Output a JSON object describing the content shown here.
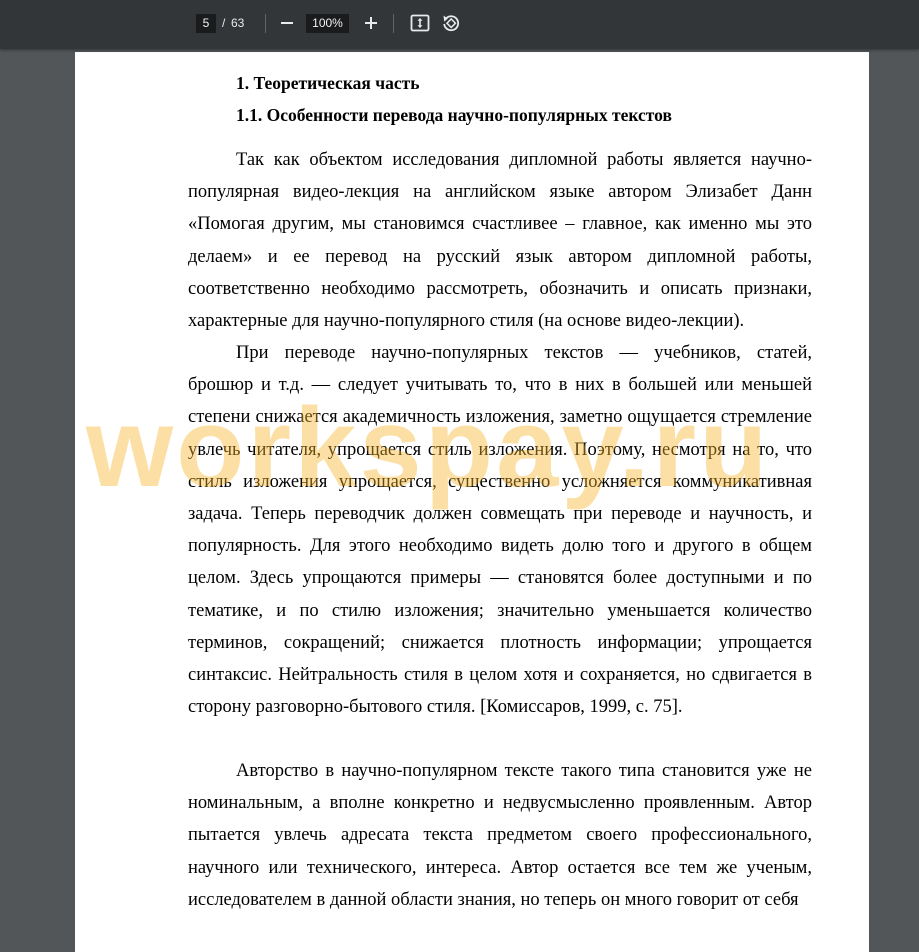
{
  "toolbar": {
    "page_current": "5",
    "page_separator": "/",
    "page_total": "63",
    "zoom_level": "100%",
    "zoom_out_icon": "minus-icon",
    "zoom_in_icon": "plus-icon",
    "fit_icon": "fit-page-icon",
    "rotate_icon": "rotate-icon"
  },
  "document": {
    "heading1": "1. Теоретическая часть",
    "heading2": "1.1. Особенности перевода научно-популярных текстов",
    "paragraph1": "Так как объектом исследования дипломной работы является научно-популярная видео-лекция на английском языке автором Элизабет Данн «Помогая другим, мы становимся счастливее – главное, как именно мы это делаем» и ее перевод на русский язык автором дипломной работы, соответственно необходимо рассмотреть, обозначить и описать признаки, характерные для научно-популярного стиля (на основе видео-лекции).",
    "paragraph2": "При переводе научно-популярных текстов — учебников, статей, брошюр и т.д. — следует учитывать то, что в них в большей или меньшей степени снижается академичность изложения, заметно ощущается стремление увлечь читателя, упрощается стиль изложения. Поэтому, несмотря на то, что стиль изложения упрощается, существенно усложняется коммуникативная задача. Теперь переводчик должен совмещать при переводе и научность, и популярность. Для этого необходимо видеть долю того и другого в общем целом. Здесь упрощаются примеры — становятся более доступными и по тематике, и по стилю изложения; значительно уменьшается количество терминов, сокращений; снижается плотность информации; упрощается синтаксис. Нейтральность стиля в целом хотя и сохраняется, но сдвигается в сторону разговорно-бытового стиля. [Комиссаров, 1999, с. 75].",
    "paragraph3": "Авторство в научно-популярном тексте такого типа становится уже не номинальным, а вполне конкретно и недвусмысленно проявленным. Автор пытается увлечь адресата текста предметом своего профессионального, научного или технического, интереса. Автор остается все тем же ученым, исследователем в данной области знания, но теперь он много говорит от себя"
  },
  "watermark": "workspay.ru"
}
